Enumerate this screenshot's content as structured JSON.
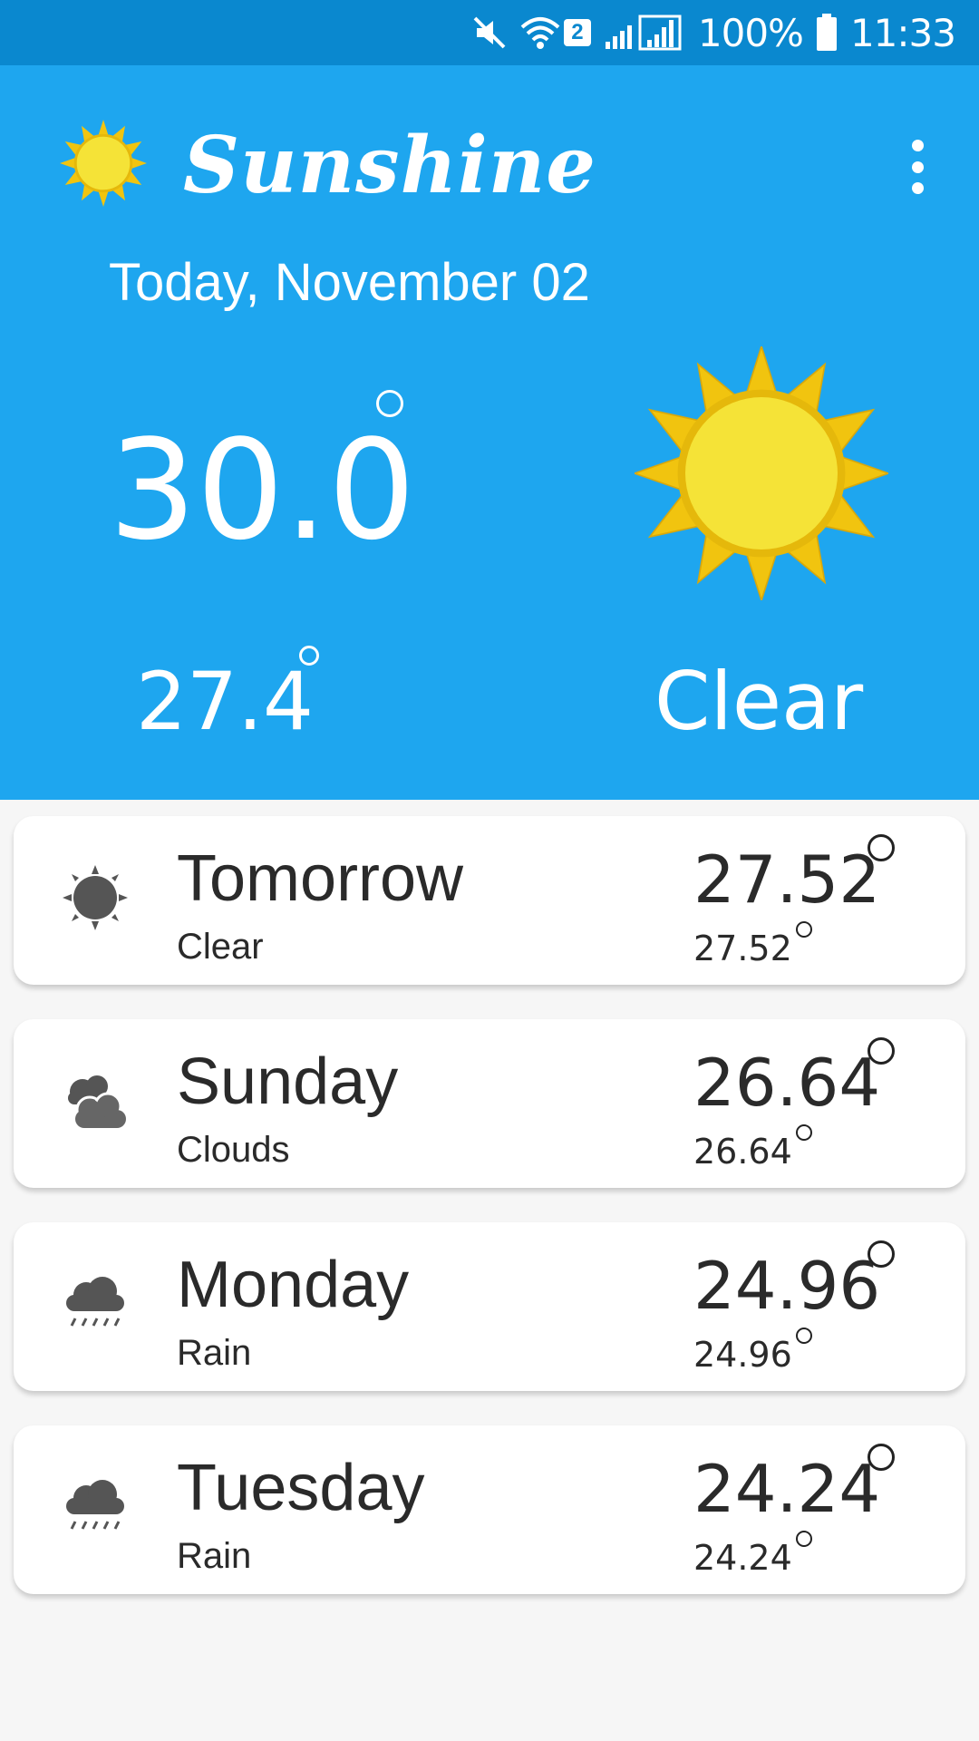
{
  "status_bar": {
    "icons": [
      "mute-icon",
      "wifi-icon",
      "sim-icon",
      "signal-icon",
      "battery-icon"
    ],
    "sim_badge": "2",
    "battery": "100%",
    "time": "11:33"
  },
  "app": {
    "title": "Sunshine",
    "logo_icon": "sun-icon",
    "menu_icon": "overflow-menu-icon"
  },
  "today": {
    "date": "Today, November 02",
    "high": "30.0",
    "low": "27.4",
    "condition": "Clear",
    "icon": "sun-icon"
  },
  "forecast": [
    {
      "day": "Tomorrow",
      "desc": "Clear",
      "high": "27.52",
      "low": "27.52",
      "icon": "clear-icon"
    },
    {
      "day": "Sunday",
      "desc": "Clouds",
      "high": "26.64",
      "low": "26.64",
      "icon": "clouds-icon"
    },
    {
      "day": "Monday",
      "desc": "Rain",
      "high": "24.96",
      "low": "24.96",
      "icon": "rain-icon"
    },
    {
      "day": "Tuesday",
      "desc": "Rain",
      "high": "24.24",
      "low": "24.24",
      "icon": "rain-icon"
    }
  ],
  "colors": {
    "status_bar": "#0a88cf",
    "header": "#1ea6ef",
    "sun_outer": "#f1c40f",
    "sun_inner": "#f5e337",
    "icon_gray": "#555555"
  }
}
